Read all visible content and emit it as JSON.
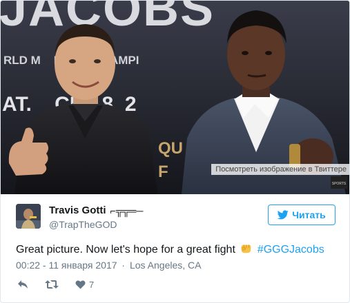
{
  "photo": {
    "poster_title": "JACOBS",
    "poster_line1": "RLD M    EIGHT CHAMPI",
    "poster_line2": "AT.    CH 18, 2",
    "poster_frag1": "QU",
    "poster_frag2": "F",
    "badge_text": "SPORTS",
    "view_tooltip": "Посмотреть изображение в Твиттере"
  },
  "user": {
    "display_name": "Travis Gotti",
    "name_suffix": "⌐╦╦═─",
    "handle": "@TrapTheGOD",
    "avatar_icon": "profile-photo"
  },
  "follow_button": {
    "label": "Читать",
    "icon": "twitter-bird-icon",
    "color": "#1da1f2"
  },
  "tweet": {
    "text": "Great picture. Now let's hope for a great fight",
    "emoji": "fist-icon",
    "hashtag": "#GGGJacobs"
  },
  "meta": {
    "time": "00:22 - 11 января 2017",
    "separator": "·",
    "location": "Los Angeles, CA"
  },
  "actions": {
    "reply_icon": "reply-icon",
    "retweet_icon": "retweet-icon",
    "like_icon": "heart-icon",
    "like_count": "7"
  },
  "colors": {
    "accent": "#1da1f2",
    "secondary_text": "#657786",
    "border": "#e1e8ed"
  }
}
